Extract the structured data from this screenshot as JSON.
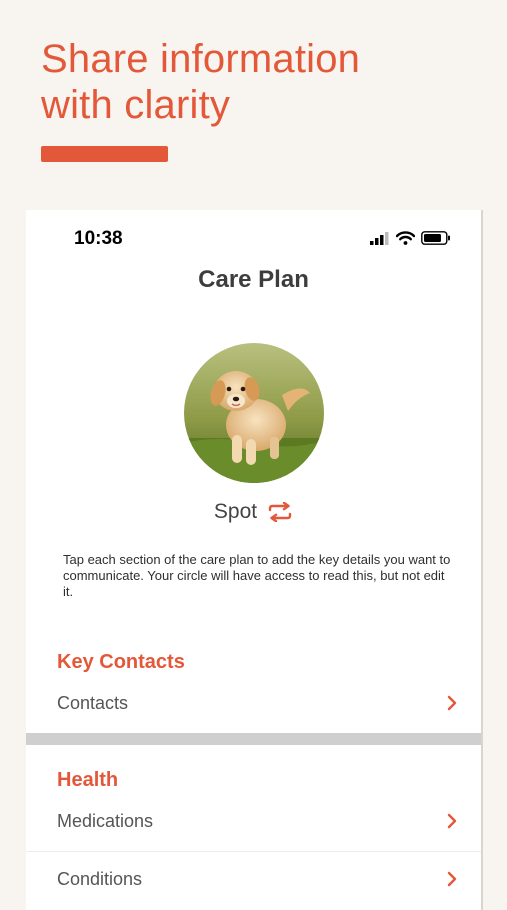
{
  "promo": {
    "headline_line1": "Share information",
    "headline_line2": "with clarity",
    "accent_color": "#e4583a",
    "background_color": "#f8f4ef"
  },
  "status_bar": {
    "time": "10:38",
    "icons": [
      "cellular-signal-icon",
      "wifi-icon",
      "battery-icon"
    ]
  },
  "screen": {
    "title": "Care Plan",
    "pet": {
      "name": "Spot",
      "avatar": "puppy-photo",
      "switch_icon": "swap-arrows-icon"
    },
    "intro_text": "Tap each section of the care plan to add the key details you want to communicate. Your circle will have access to read this, but not edit it.",
    "sections": [
      {
        "title": "Key Contacts",
        "items": [
          {
            "label": "Contacts",
            "icon": "chevron-right-icon"
          }
        ]
      },
      {
        "title": "Health",
        "items": [
          {
            "label": "Medications",
            "icon": "chevron-right-icon"
          },
          {
            "label": "Conditions",
            "icon": "chevron-right-icon"
          }
        ]
      }
    ]
  }
}
